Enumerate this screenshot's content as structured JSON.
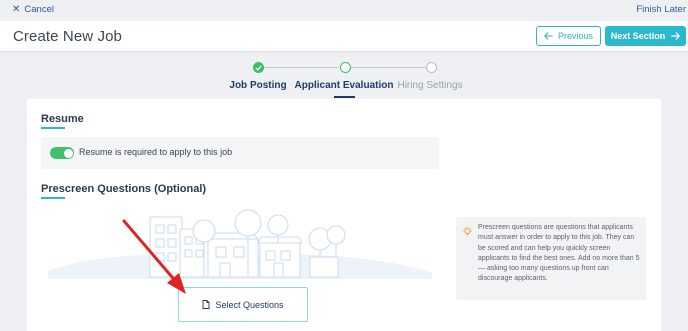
{
  "topbar": {
    "cancel_label": "Cancel",
    "finish_label": "Finish Later"
  },
  "header": {
    "title": "Create New Job",
    "previous_label": "Previous",
    "next_label": "Next Section"
  },
  "steps": [
    {
      "label": "Job Posting",
      "state": "done"
    },
    {
      "label": "Applicant Evaluation",
      "state": "active"
    },
    {
      "label": "Hiring Settings",
      "state": "todo"
    }
  ],
  "resume": {
    "title": "Resume",
    "toggle_on": true,
    "toggle_label": "Resume is required to apply to this job"
  },
  "prescreen": {
    "title": "Prescreen Questions (Optional)",
    "select_label": "Select Questions",
    "tip": "Prescreen questions are questions that applicants must answer in order to apply to this job. They can be scored and can help you quickly screen applicants to find the best ones. Add no more than 5 — asking too many questions up front can discourage applicants."
  },
  "colors": {
    "accent": "#2cb9cf",
    "success": "#3bbf64",
    "navy": "#1f3a66",
    "annotation_arrow": "#e02424"
  }
}
